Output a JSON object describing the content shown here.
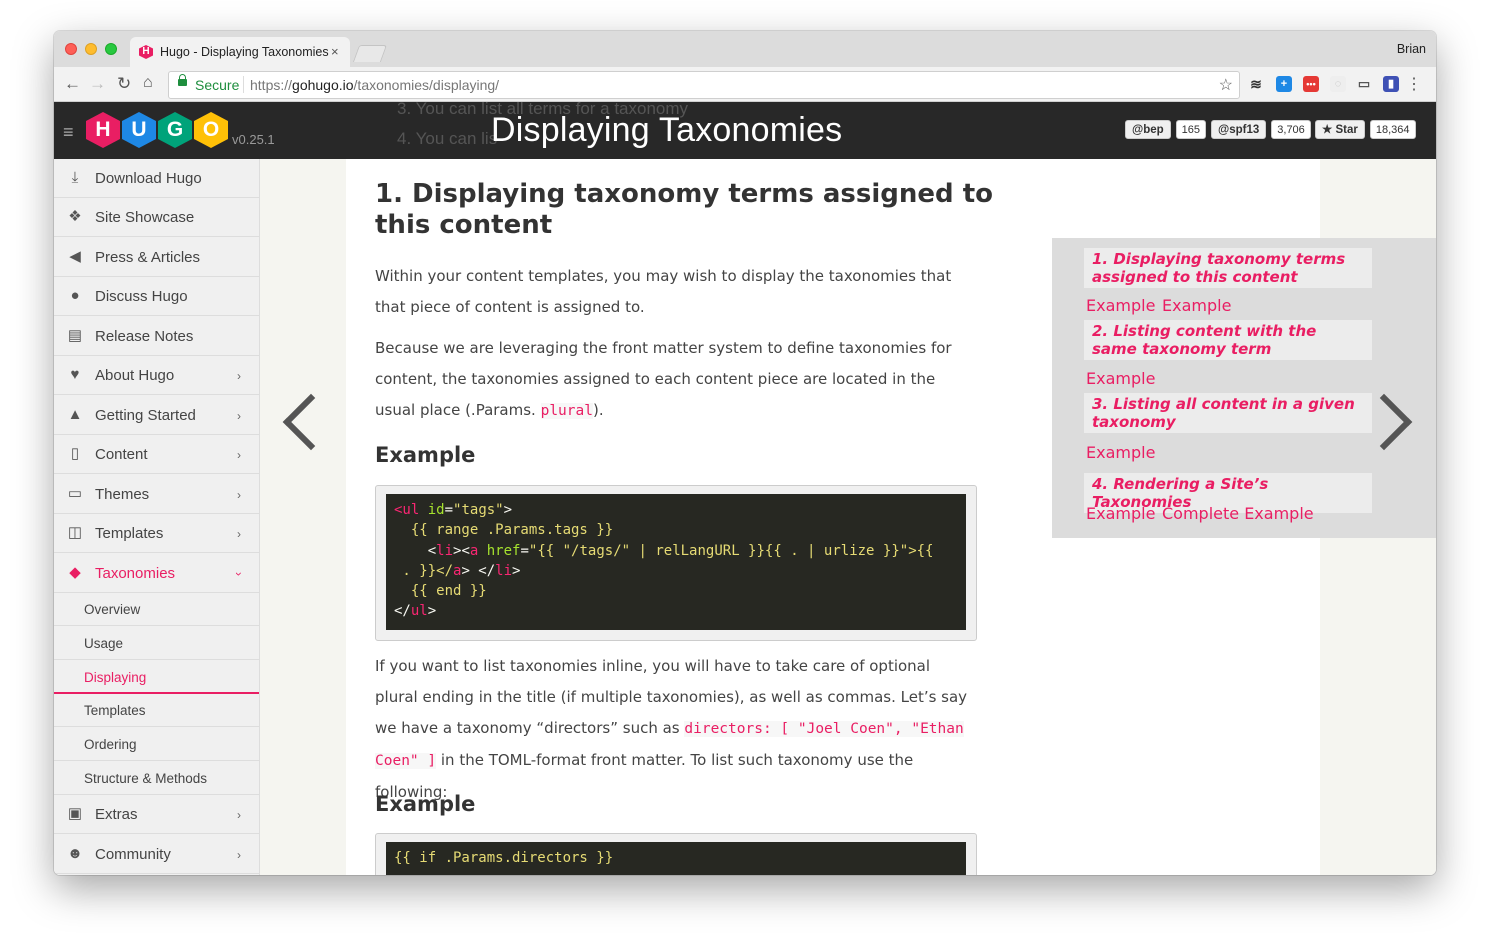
{
  "browser": {
    "tab_title": "Hugo - Displaying Taxonomies",
    "tab_close": "×",
    "user_name": "Brian",
    "secure_label": "Secure",
    "url_scheme": "https://",
    "url_host": "gohugo.io",
    "url_path": "/taxonomies/displaying/"
  },
  "header": {
    "logo_letters": [
      "H",
      "U",
      "G",
      "O"
    ],
    "version": "v0.25.1",
    "page_title": "Displaying Taxonomies",
    "ghost_line_1": "3. You can list all terms for a taxonomy",
    "ghost_line_2": "4. You can lis",
    "github": [
      {
        "label": "@bep",
        "count": "165"
      },
      {
        "label": "@spf13",
        "count": "3,706"
      },
      {
        "label": "★ Star",
        "count": "18,364"
      }
    ]
  },
  "sidebar": {
    "items": [
      {
        "label": "Download Hugo",
        "icon": "download-icon"
      },
      {
        "label": "Site Showcase",
        "icon": "cubes-icon"
      },
      {
        "label": "Press & Articles",
        "icon": "bullhorn-icon"
      },
      {
        "label": "Discuss Hugo",
        "icon": "comments-icon"
      },
      {
        "label": "Release Notes",
        "icon": "newspaper-icon"
      },
      {
        "label": "About Hugo",
        "icon": "heart-icon"
      },
      {
        "label": "Getting Started",
        "icon": "road-icon"
      },
      {
        "label": "Content",
        "icon": "file-icon"
      },
      {
        "label": "Themes",
        "icon": "desktop-icon"
      },
      {
        "label": "Templates",
        "icon": "columns-icon"
      },
      {
        "label": "Taxonomies",
        "icon": "tags-icon"
      },
      {
        "label": "Extras",
        "icon": "gift-icon"
      },
      {
        "label": "Community",
        "icon": "users-icon"
      }
    ],
    "sub_items": [
      "Overview",
      "Usage",
      "Displaying",
      "Templates",
      "Ordering",
      "Structure & Methods"
    ]
  },
  "main": {
    "heading": "1. Displaying taxonomy terms assigned to this content",
    "para1": "Within your content templates, you may wish to display the taxonomies that that piece of content is assigned to.",
    "para2_a": "Because we are leveraging the front matter system to define taxonomies for content, the taxonomies assigned to each content piece are located in the usual place (.Params. ",
    "para2_code": "plural",
    "para2_b": ").",
    "example_1": "Example",
    "code1": {
      "l1_tag": "<ul",
      "l1_attr": " id",
      "l1_eq": "=",
      "l1_str": "\"tags\"",
      "l1_end": ">",
      "l2": "  {{ range .Params.tags }}",
      "l3_a": "    <",
      "l3_li": "li",
      "l3_b": "><",
      "l3_aa": "a",
      "l3_href": " href",
      "l3_c": "=",
      "l3_str": "\"{{ \"/tags/\" | relLangURL }}{{ . | urlize }}\"",
      "l3_d": ">{{",
      "l4_a": " . }}</",
      "l4_aa": "a",
      "l4_b": "> </",
      "l4_li": "li",
      "l4_c": ">",
      "l5": "  {{ end }}",
      "l6_a": "</",
      "l6_ul": "ul",
      "l6_b": ">"
    },
    "para3_a": "If you want to list taxonomies inline, you will have to take care of optional plural ending in the title (if multiple taxonomies), as well as commas. Let’s say we have a taxonomy “directors” such as ",
    "para3_code": "directors: [ \"Joel Coen\", \"Ethan Coen\" ]",
    "para3_b": " in the TOML-format front matter. To list such taxonomy use the following:",
    "example_2": "Example",
    "code2_line1": "{{ if .Params.directors }}"
  },
  "toc": {
    "h1": "1. Displaying taxonomy terms assigned to this content",
    "h1_links": [
      "Example",
      "Example"
    ],
    "h2": "2. Listing content with the same taxonomy term",
    "h2_links": [
      "Example"
    ],
    "h3": "3. Listing all content in a given taxonomy",
    "h3_links": [
      "Example"
    ],
    "h4": "4. Rendering a Site’s Taxonomies",
    "h4_links": [
      "Example",
      "Complete Example"
    ]
  }
}
